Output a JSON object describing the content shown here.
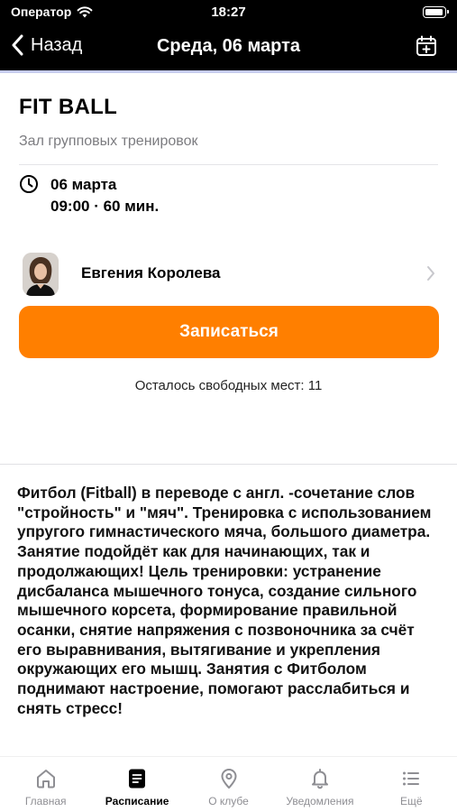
{
  "status_bar": {
    "carrier": "Оператор",
    "time": "18:27"
  },
  "nav": {
    "back_label": "Назад",
    "title": "Среда, 06 марта",
    "icons": [
      "chevron-left-icon",
      "calendar-add-icon"
    ]
  },
  "session": {
    "title": "FIT BALL",
    "hall": "Зал групповых тренировок",
    "date": "06 марта",
    "time_duration": "09:00 · 60 мин."
  },
  "trainer": {
    "name": "Евгения Королева"
  },
  "signup": {
    "button_label": "Записаться",
    "seats_left": "Осталось свободных мест: 11"
  },
  "description": "Фитбол (Fitball) в переводе с англ. -сочетание слов \"стройность\" и \"мяч\". Тренировка с использованием упругого гимнастического мяча, большого диаметра. Занятие подойдёт как для начинающих, так и продолжающих! Цель тренировки: устранение дисбаланса мышечного тонуса, создание сильного мышечного корсета, формирование правильной осанки, снятие напряжения с позвоночника за счёт его выравнивания, вытягивание и укрепления окружающих его мышц. Занятия с Фитболом поднимают настроение, помогают расслабиться и снять стресс!",
  "tabs": [
    {
      "label": "Главная",
      "icon": "home-icon",
      "active": false
    },
    {
      "label": "Расписание",
      "icon": "schedule-icon",
      "active": true
    },
    {
      "label": "О клубе",
      "icon": "location-pin-icon",
      "active": false
    },
    {
      "label": "Уведомления",
      "icon": "bell-icon",
      "active": false
    },
    {
      "label": "Ещё",
      "icon": "more-list-icon",
      "active": false
    }
  ],
  "colors": {
    "accent": "#ff7f00",
    "nav_bg": "#000000",
    "muted_text": "#7c7c80"
  }
}
